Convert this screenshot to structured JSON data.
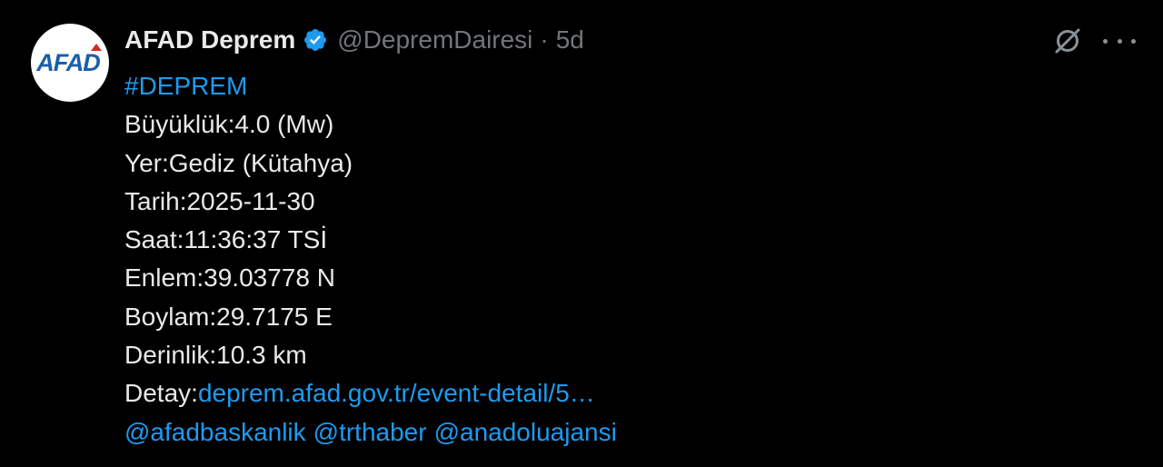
{
  "author": {
    "display_name": "AFAD Deprem",
    "handle": "@DepremDairesi",
    "separator": "·",
    "time": "5d",
    "avatar_text": "AFAD"
  },
  "colors": {
    "background": "#000000",
    "text": "#e7e9ea",
    "muted": "#71767b",
    "link": "#1d9bf0",
    "avatar_logo": "#1b5faa"
  },
  "icons": {
    "verified": "verified-badge-icon",
    "grok": "grok-icon",
    "more": "more-options-icon"
  },
  "tweet": {
    "hashtag": "#DEPREM",
    "lines": [
      "Büyüklük:4.0 (Mw)",
      "Yer:Gediz (Kütahya)",
      "Tarih:2025-11-30",
      "Saat:11:36:37 TSİ",
      "Enlem:39.03778 N",
      "Boylam:29.7175 E",
      "Derinlik:10.3 km"
    ],
    "detail_label": "Detay:",
    "detail_link": "deprem.afad.gov.tr/event-detail/5…",
    "mentions": [
      "@afadbaskanlik",
      "@trthaber",
      "@anadoluajansi"
    ]
  }
}
